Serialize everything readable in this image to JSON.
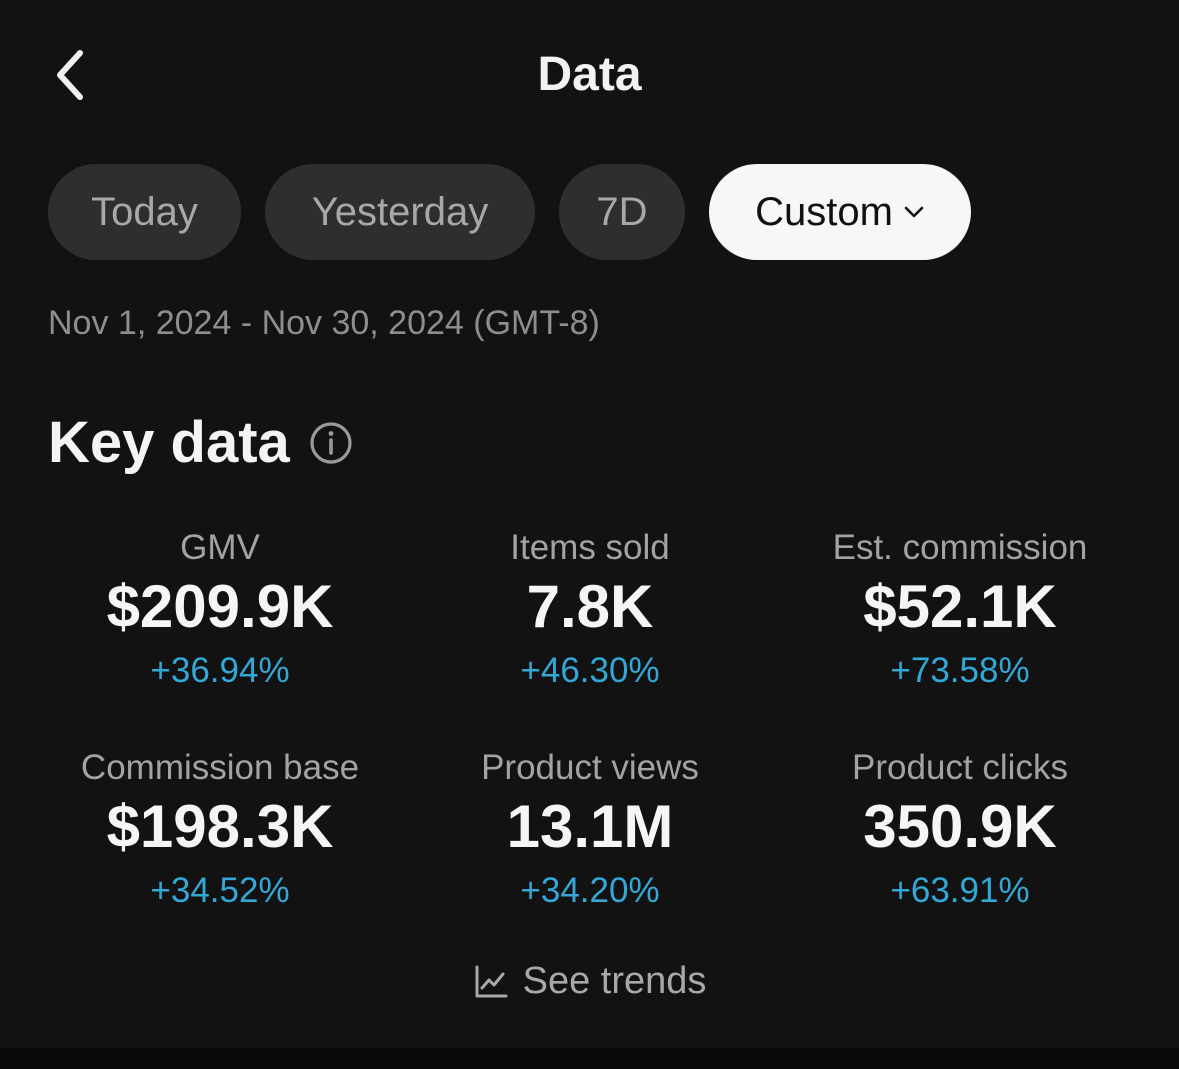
{
  "header": {
    "title": "Data"
  },
  "tabs": [
    {
      "label": "Today"
    },
    {
      "label": "Yesterday"
    },
    {
      "label": "7D"
    },
    {
      "label": "Custom"
    }
  ],
  "date_range": "Nov 1, 2024 - Nov 30, 2024 (GMT-8)",
  "key_data": {
    "title": "Key data",
    "metrics": [
      {
        "label": "GMV",
        "value": "$209.9K",
        "change": "+36.94%"
      },
      {
        "label": "Items sold",
        "value": "7.8K",
        "change": "+46.30%"
      },
      {
        "label": "Est. commission",
        "value": "$52.1K",
        "change": "+73.58%"
      },
      {
        "label": "Commission base",
        "value": "$198.3K",
        "change": "+34.52%"
      },
      {
        "label": "Product views",
        "value": "13.1M",
        "change": "+34.20%"
      },
      {
        "label": "Product clicks",
        "value": "350.9K",
        "change": "+63.91%"
      }
    ]
  },
  "trends_label": "See trends",
  "colors": {
    "background": "#121212",
    "positive_change": "#33a8d6",
    "selected_tab_bg": "#f7f7f7",
    "tab_bg": "#2e2e2e"
  },
  "icons": {
    "back": "chevron-left-icon",
    "dropdown": "chevron-down-icon",
    "info": "info-icon",
    "trends": "line-chart-icon"
  }
}
